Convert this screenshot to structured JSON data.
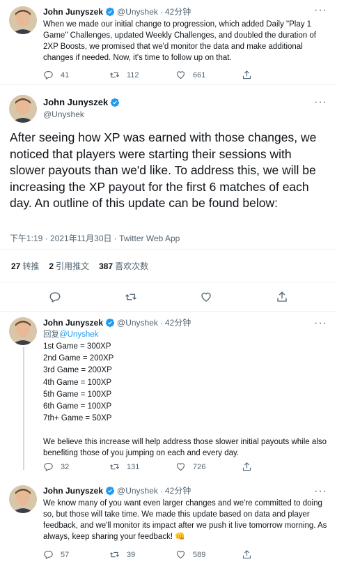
{
  "colors": {
    "accent": "#1d9bf0",
    "muted": "#536471",
    "text": "#0f1419"
  },
  "author": {
    "name": "John Junyszek",
    "handle": "@Unyshek"
  },
  "tweet1": {
    "time": "42分钟",
    "text": "When we made our initial change to progression, which added Daily \"Play 1 Game\" Challenges, updated Weekly Challenges, and doubled the duration of 2XP Boosts, we promised that we'd monitor the data and make additional changes if needed. Now, it's time to follow up on that.",
    "replies": "41",
    "retweets": "112",
    "likes": "661"
  },
  "main": {
    "text": "After seeing how XP was earned with those changes, we noticed that players were starting their sessions with slower payouts than we'd like. To address this, we will be increasing the XP payout for the first 6 matches of each day. An outline of this update can be found below:",
    "meta": "下午1:19 · 2021年11月30日 · Twitter Web App",
    "retweets_count": "27",
    "retweets_label": "转推",
    "quotes_count": "2",
    "quotes_label": "引用推文",
    "likes_count": "387",
    "likes_label": "喜欢次数"
  },
  "tweet3": {
    "time": "42分钟",
    "reply_prefix": "回复",
    "reply_handle": "@Unyshek",
    "lines": [
      "1st Game = 300XP",
      "2nd Game = 200XP",
      "3rd Game = 200XP",
      "4th Game = 100XP",
      "5th Game = 100XP",
      "6th Game = 100XP",
      "7th+ Game = 50XP"
    ],
    "paragraph": "We believe this increase will help address those slower initial payouts while also benefiting those of you jumping on each and every day.",
    "replies": "32",
    "retweets": "131",
    "likes": "726"
  },
  "tweet4": {
    "time": "42分钟",
    "text": "We know many of you want even larger changes and we're committed to doing so, but those will take time. We made this update based on data and player feedback, and we'll monitor its impact after we push it live tomorrow morning. As always, keep sharing your feedback! 👊",
    "replies": "57",
    "retweets": "39",
    "likes": "589"
  }
}
